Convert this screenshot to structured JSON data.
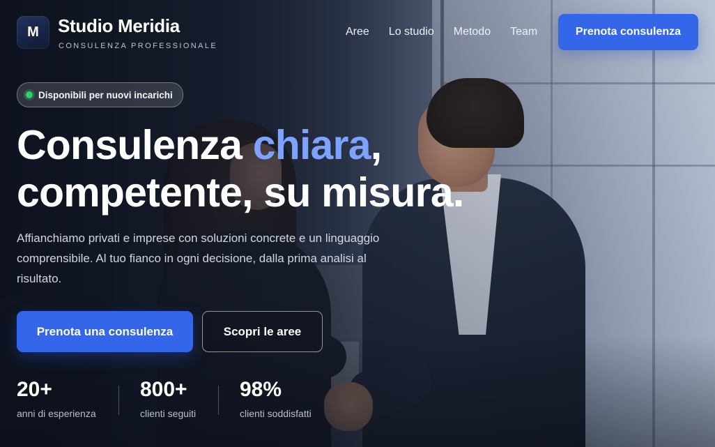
{
  "brand": {
    "logo_letter": "M",
    "name": "Studio Meridia",
    "tagline": "CONSULENZA PROFESSIONALE"
  },
  "nav": {
    "items": [
      {
        "label": "Aree"
      },
      {
        "label": "Lo studio"
      },
      {
        "label": "Metodo"
      },
      {
        "label": "Team"
      }
    ],
    "cta_label": "Prenota consulenza"
  },
  "hero": {
    "badge": "Disponibili per nuovi incarichi",
    "headline_part1": "Consulenza ",
    "headline_accent": "chiara",
    "headline_part2": ",",
    "headline_line2": "competente, su misura.",
    "lead": "Affianchiamo privati e imprese con soluzioni concrete e un linguaggio comprensibile. Al tuo fianco in ogni decisione, dalla prima analisi al risultato.",
    "primary_button": "Prenota una consulenza",
    "secondary_button": "Scopri le aree"
  },
  "stats": [
    {
      "value": "20+",
      "label": "anni di esperienza"
    },
    {
      "value": "800+",
      "label": "clienti seguiti"
    },
    {
      "value": "98%",
      "label": "clienti soddisfatti"
    }
  ],
  "colors": {
    "accent": "#3466ea",
    "headline_accent": "#7ea2ff",
    "status_dot": "#2fcf6b"
  },
  "icons": {
    "logo": "monogram-logo",
    "badge": "status-dot-icon"
  }
}
